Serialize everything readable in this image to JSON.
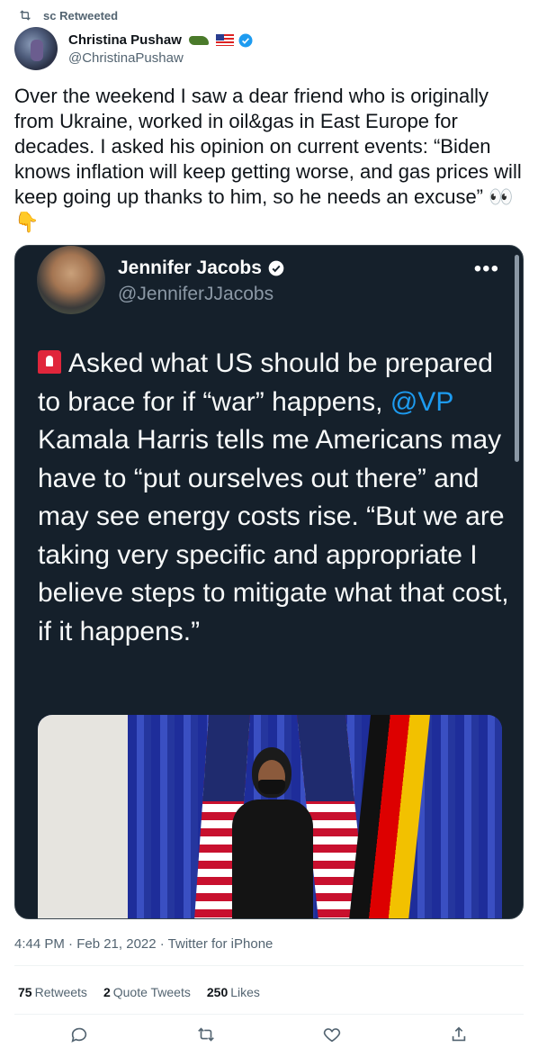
{
  "retweet_banner": {
    "text": "sc Retweeted",
    "icon": "retweet-icon"
  },
  "tweet": {
    "author": {
      "name": "Christina Pushaw",
      "handle": "@ChristinaPushaw",
      "name_emojis": [
        "crocodile-emoji",
        "us-flag-emoji"
      ],
      "verified": true
    },
    "text": "Over the weekend I saw a dear friend who is originally from Ukraine, worked in oil&gas in East Europe for decades. I asked his opinion on current events: “Biden knows inflation will keep getting worse, and gas prices will keep going up thanks to him, so he needs an excuse” 👀👇",
    "quoted": {
      "author": {
        "name": "Jennifer Jacobs",
        "handle": "@JenniferJJacobs",
        "verified": true
      },
      "more_icon": "•••",
      "text_parts": {
        "before": "Asked what US should be prepared to brace for if “war” happens, ",
        "link": "@VP",
        "after": " Kamala Harris tells me Americans may have to “put ourselves out there” and may see energy costs rise. “But we are taking very specific and appropriate I believe steps to mitigate what that cost, if it happens.”"
      },
      "leading_emoji": "siren-emoji"
    },
    "meta": "4:44 PM · Feb 21, 2022 · Twitter for iPhone",
    "stats": [
      {
        "count": "75",
        "label": "Retweets"
      },
      {
        "count": "2",
        "label": "Quote Tweets"
      },
      {
        "count": "250",
        "label": "Likes"
      }
    ],
    "actions": [
      "reply-icon",
      "retweet-icon",
      "like-icon",
      "share-icon"
    ],
    "colors": {
      "link": "#1d9bf0",
      "verified": "#1d9bf0",
      "quote_bg": "#15202b",
      "muted": "#536471"
    }
  }
}
